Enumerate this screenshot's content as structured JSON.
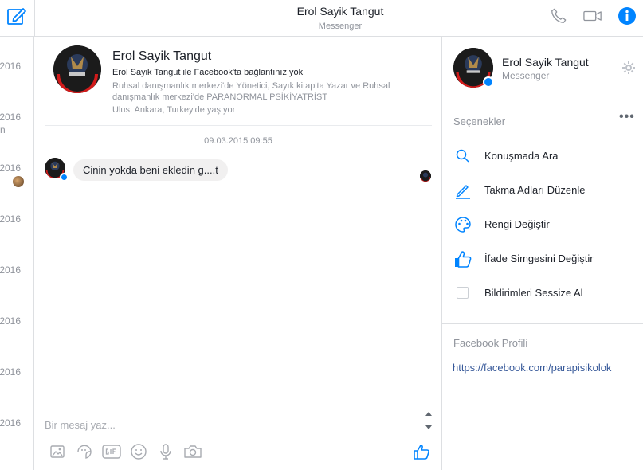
{
  "header": {
    "title": "Erol Sayik Tangut",
    "subtitle": "Messenger"
  },
  "thread_list": {
    "dates": [
      ".2016",
      ".2016",
      ".2016",
      ".2016",
      ".2016",
      ".2016",
      ".2016",
      ".2016"
    ],
    "snippet": "n"
  },
  "conversation": {
    "name": "Erol Sayik Tangut",
    "connection": "Erol Sayik Tangut ile Facebook'ta bağlantınız yok",
    "work": "Ruhsal danışmanlık merkezi'de Yönetici, Sayık kitap'ta Yazar ve Ruhsal danışmanlık merkezi'de PARANORMAL PSİKİYATRİST",
    "location": "Ulus, Ankara, Turkey'de yaşıyor",
    "timestamp": "09.03.2015 09:55",
    "messages": [
      {
        "text": "Cinin yokda beni ekledin g....t"
      }
    ]
  },
  "composer": {
    "placeholder": "Bir mesaj yaz..."
  },
  "right_panel": {
    "name": "Erol Sayik Tangut",
    "subtitle": "Messenger",
    "options_title": "Seçenekler",
    "options": [
      {
        "label": "Konuşmada Ara",
        "icon": "search-icon"
      },
      {
        "label": "Takma Adları Düzenle",
        "icon": "pencil-icon"
      },
      {
        "label": "Rengi Değiştir",
        "icon": "palette-icon"
      },
      {
        "label": "İfade Simgesini Değiştir",
        "icon": "thumbs-up-icon"
      },
      {
        "label": "Bildirimleri Sessize Al",
        "icon": "checkbox"
      }
    ],
    "profile_title": "Facebook Profili",
    "profile_link": "https://facebook.com/parapisikolok"
  },
  "colors": {
    "accent": "#0084ff",
    "link": "#365899",
    "muted": "#90949c",
    "bubble": "#f1f0f0"
  }
}
